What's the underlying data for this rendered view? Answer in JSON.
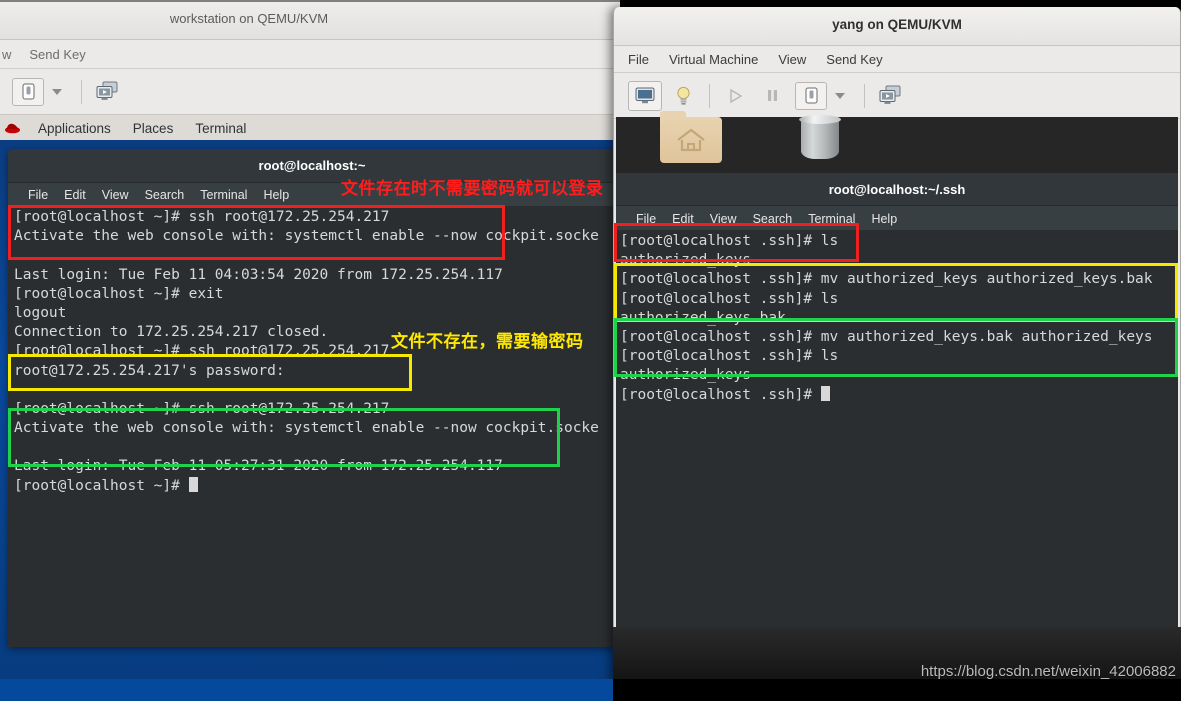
{
  "left_window": {
    "title": "workstation on QEMU/KVM",
    "menubar": [
      "w",
      "Send Key"
    ],
    "toolbar": {
      "console_icon": "monitor-toggle-icon",
      "caret_icon": "chevron-down-icon",
      "fullscreen_icon": "multi-monitor-icon"
    },
    "gnome_panel": [
      "Applications",
      "Places",
      "Terminal"
    ],
    "gnome_logo": "redhat-logo-icon",
    "terminal": {
      "title": "root@localhost:~",
      "menu": [
        "File",
        "Edit",
        "View",
        "Search",
        "Terminal",
        "Help"
      ],
      "lines": [
        "[root@localhost ~]# ssh root@172.25.254.217",
        "Activate the web console with: systemctl enable --now cockpit.socke",
        "",
        "Last login: Tue Feb 11 04:03:54 2020 from 172.25.254.117",
        "[root@localhost ~]# exit",
        "logout",
        "Connection to 172.25.254.217 closed.",
        "[root@localhost ~]# ssh root@172.25.254.217",
        "root@172.25.254.217's password:",
        "",
        "[root@localhost ~]# ssh root@172.25.254.217",
        "Activate the web console with: systemctl enable --now cockpit.socke",
        "",
        "Last login: Tue Feb 11 05:27:31 2020 from 172.25.254.117",
        "[root@localhost ~]# "
      ]
    }
  },
  "right_window": {
    "title": "yang on QEMU/KVM",
    "menubar": [
      "File",
      "Virtual Machine",
      "View",
      "Send Key"
    ],
    "toolbar": {
      "console_icon": "monitor-icon",
      "details_icon": "lightbulb-icon",
      "run_icon": "play-icon",
      "pause_icon": "pause-icon",
      "shutdown_icon": "power-toggle-icon",
      "caret_icon": "chevron-down-icon",
      "fullscreen_icon": "multi-monitor-icon"
    },
    "desktop": {
      "home_icon": "home-folder-icon",
      "trash_icon": "trash-can-icon"
    },
    "terminal": {
      "title": "root@localhost:~/.ssh",
      "menu": [
        "File",
        "Edit",
        "View",
        "Search",
        "Terminal",
        "Help"
      ],
      "lines": [
        "[root@localhost .ssh]# ls",
        "authorized_keys",
        "[root@localhost .ssh]# mv authorized_keys authorized_keys.bak",
        "[root@localhost .ssh]# ls",
        "authorized_keys.bak",
        "[root@localhost .ssh]# mv authorized_keys.bak authorized_keys",
        "[root@localhost .ssh]# ls",
        "authorized_keys",
        "[root@localhost .ssh]# "
      ]
    }
  },
  "annotations": {
    "red_note": "文件存在时不需要密码就可以登录",
    "yellow_note": "文件不存在，需要输密码"
  },
  "watermark": "https://blog.csdn.net/weixin_42006882",
  "colors": {
    "red_box": "#f21f1f",
    "yellow_box": "#f5e900",
    "green_box": "#1fd14b",
    "terminal_bg": "#2a2e31",
    "desktop_blue": "#0a4a9e"
  }
}
